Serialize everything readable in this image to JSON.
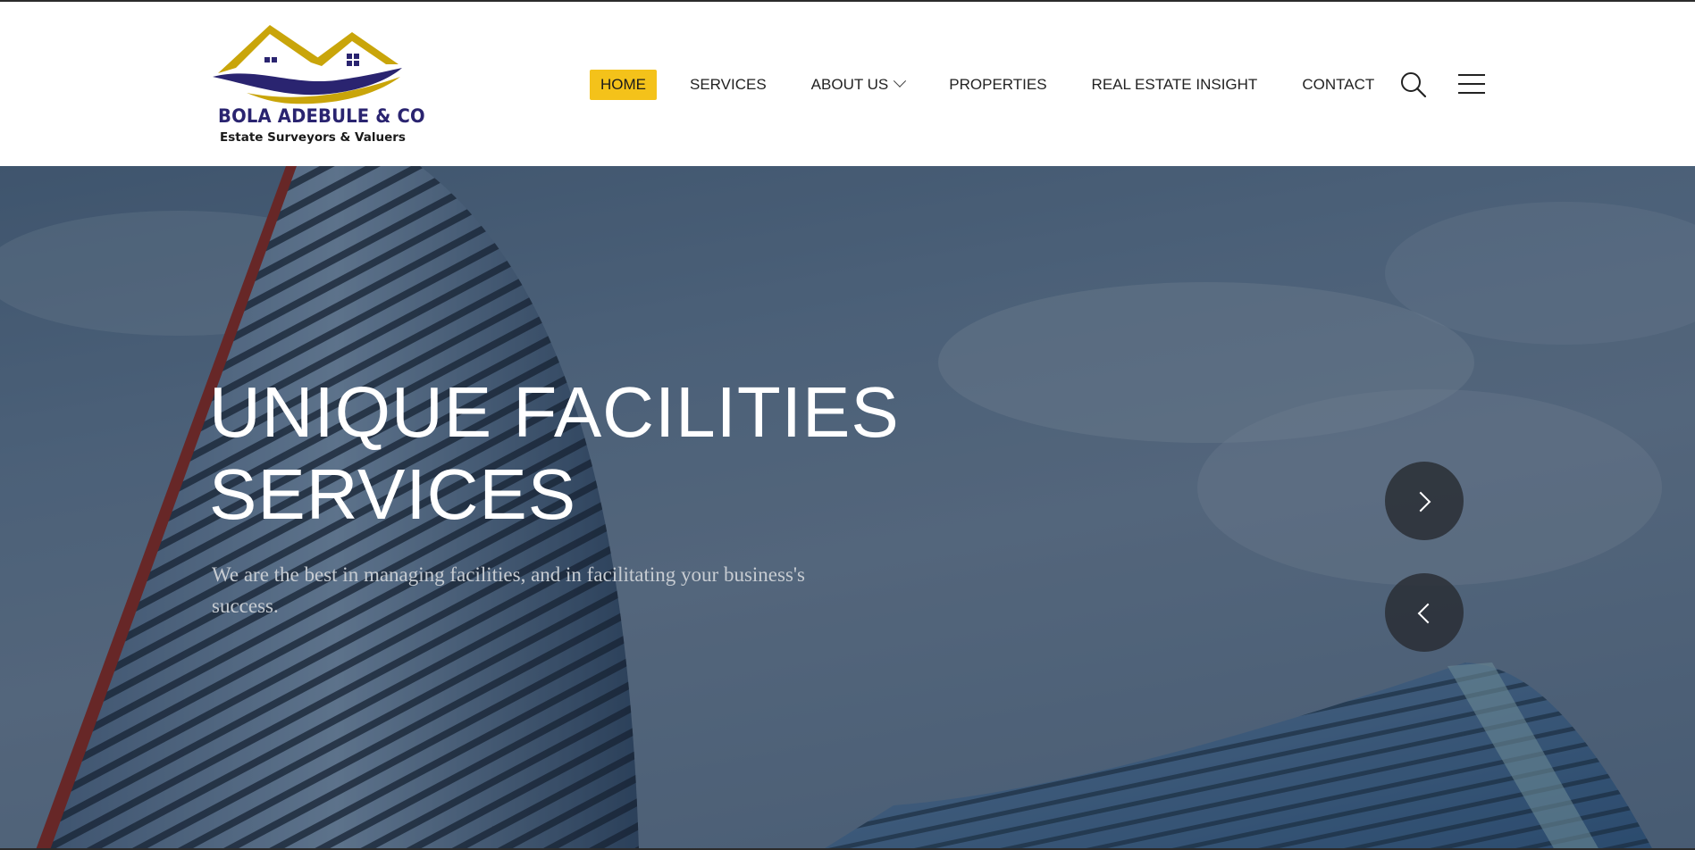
{
  "brand": {
    "name": "BOLA ADEBULE & CO",
    "tagline": "Estate Surveyors & Valuers",
    "colors": {
      "gold": "#c9a50a",
      "navy": "#2a2470"
    }
  },
  "nav": {
    "items": [
      {
        "label": "HOME",
        "active": true
      },
      {
        "label": "SERVICES"
      },
      {
        "label": "ABOUT US",
        "has_dropdown": true
      },
      {
        "label": "PROPERTIES"
      },
      {
        "label": "REAL ESTATE INSIGHT"
      },
      {
        "label": "CONTACT"
      }
    ],
    "accent_color": "#f4c21a",
    "icons": [
      "search-icon",
      "hamburger-menu-icon"
    ]
  },
  "hero": {
    "title_line1": "UNIQUE FACILITIES",
    "title_line2": "SERVICES",
    "subtitle": "We are the best in managing facilities, and in facilitating your business's success.",
    "controls": [
      "chevron-right-icon",
      "chevron-left-icon"
    ]
  }
}
